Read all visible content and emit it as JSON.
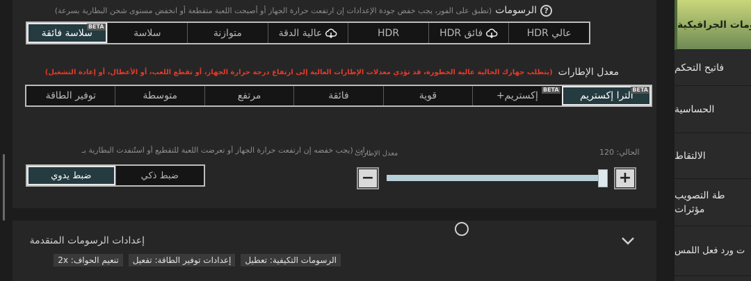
{
  "graphics": {
    "title": "الرسومات",
    "note": "(تطبق على الفور، يجب خفض جودة الإعدادات إن ارتفعت حرارة الجهاز أو أصبحت اللعبة متقطعة أو انخفض مستوى شحن البطارية بسرعة)",
    "options": [
      {
        "label": "عالي HDR",
        "beta": "",
        "cloud": false,
        "selected": false
      },
      {
        "label": "فائق HDR",
        "beta": "",
        "cloud": true,
        "selected": false
      },
      {
        "label": "HDR",
        "beta": "",
        "cloud": false,
        "selected": false
      },
      {
        "label": "عالية الدقة",
        "beta": "",
        "cloud": true,
        "selected": false
      },
      {
        "label": "متوازنة",
        "beta": "",
        "cloud": false,
        "selected": false
      },
      {
        "label": "سلاسة",
        "beta": "",
        "cloud": false,
        "selected": false
      },
      {
        "label": "سلاسة فائقة",
        "beta": "BETA",
        "cloud": false,
        "selected": true
      }
    ]
  },
  "fps": {
    "title": "معدل الإطارات",
    "warning": "(يتطلب جهازك الحالية عالية الخطورة، قد تؤدي معدلات الإطارات العالية إلى ارتفاع درجة حرارة الجهاز، أو تقطع اللعب، أو الأعطال، أو إعادة التشغيل)",
    "options": [
      {
        "label": "ألترا إكستريم",
        "beta": "BETA",
        "selected": true
      },
      {
        "label": "إكستريم+",
        "beta": "BETA",
        "selected": false
      },
      {
        "label": "قوية",
        "beta": "",
        "selected": false
      },
      {
        "label": "فائقة",
        "beta": "",
        "selected": false
      },
      {
        "label": "مرتفع",
        "beta": "",
        "selected": false
      },
      {
        "label": "متوسطة",
        "beta": "",
        "selected": false
      },
      {
        "label": "توفير الطاقة",
        "beta": "",
        "selected": false
      }
    ]
  },
  "frame_limit": {
    "title": "رات (يجب خفضه إن ارتفعت حرارة الجهاز أو تعرضت اللعبة للتقطيع أو استُنفدت البطارية بـ",
    "slider_label": "معدل الإطارات",
    "current_text": "الحالي: 120",
    "value": 120,
    "fill_fraction": 1.0,
    "minus_symbol": "−",
    "plus_symbol": "+",
    "modes": [
      {
        "label": "ضبط ذكي",
        "selected": false
      },
      {
        "label": "ضبط يدوي",
        "selected": true
      }
    ]
  },
  "advanced": {
    "title": "إعدادات الرسومات المتقدمة",
    "tags": [
      "الرسومات التكيفية: تعطيل",
      "إعدادات توفير الطاقة: تفعيل",
      "تنعيم الحواف: 2x"
    ]
  },
  "sidebar": {
    "items": [
      {
        "label": "ومات الجرافيكية",
        "active": true
      },
      {
        "label": "فاتيح التحكم",
        "active": false
      },
      {
        "label": "الحساسية",
        "active": false
      },
      {
        "label": "الالتقاط",
        "active": false
      },
      {
        "label": "طة التصويب",
        "label2": "مؤثرات",
        "active": false
      },
      {
        "label": "ت ورد فعل اللمس",
        "active": false
      }
    ]
  },
  "colors": {
    "accent_active": "#c9d67a",
    "warning": "#e53a2a",
    "slider_fill": "#b7cfd6"
  }
}
